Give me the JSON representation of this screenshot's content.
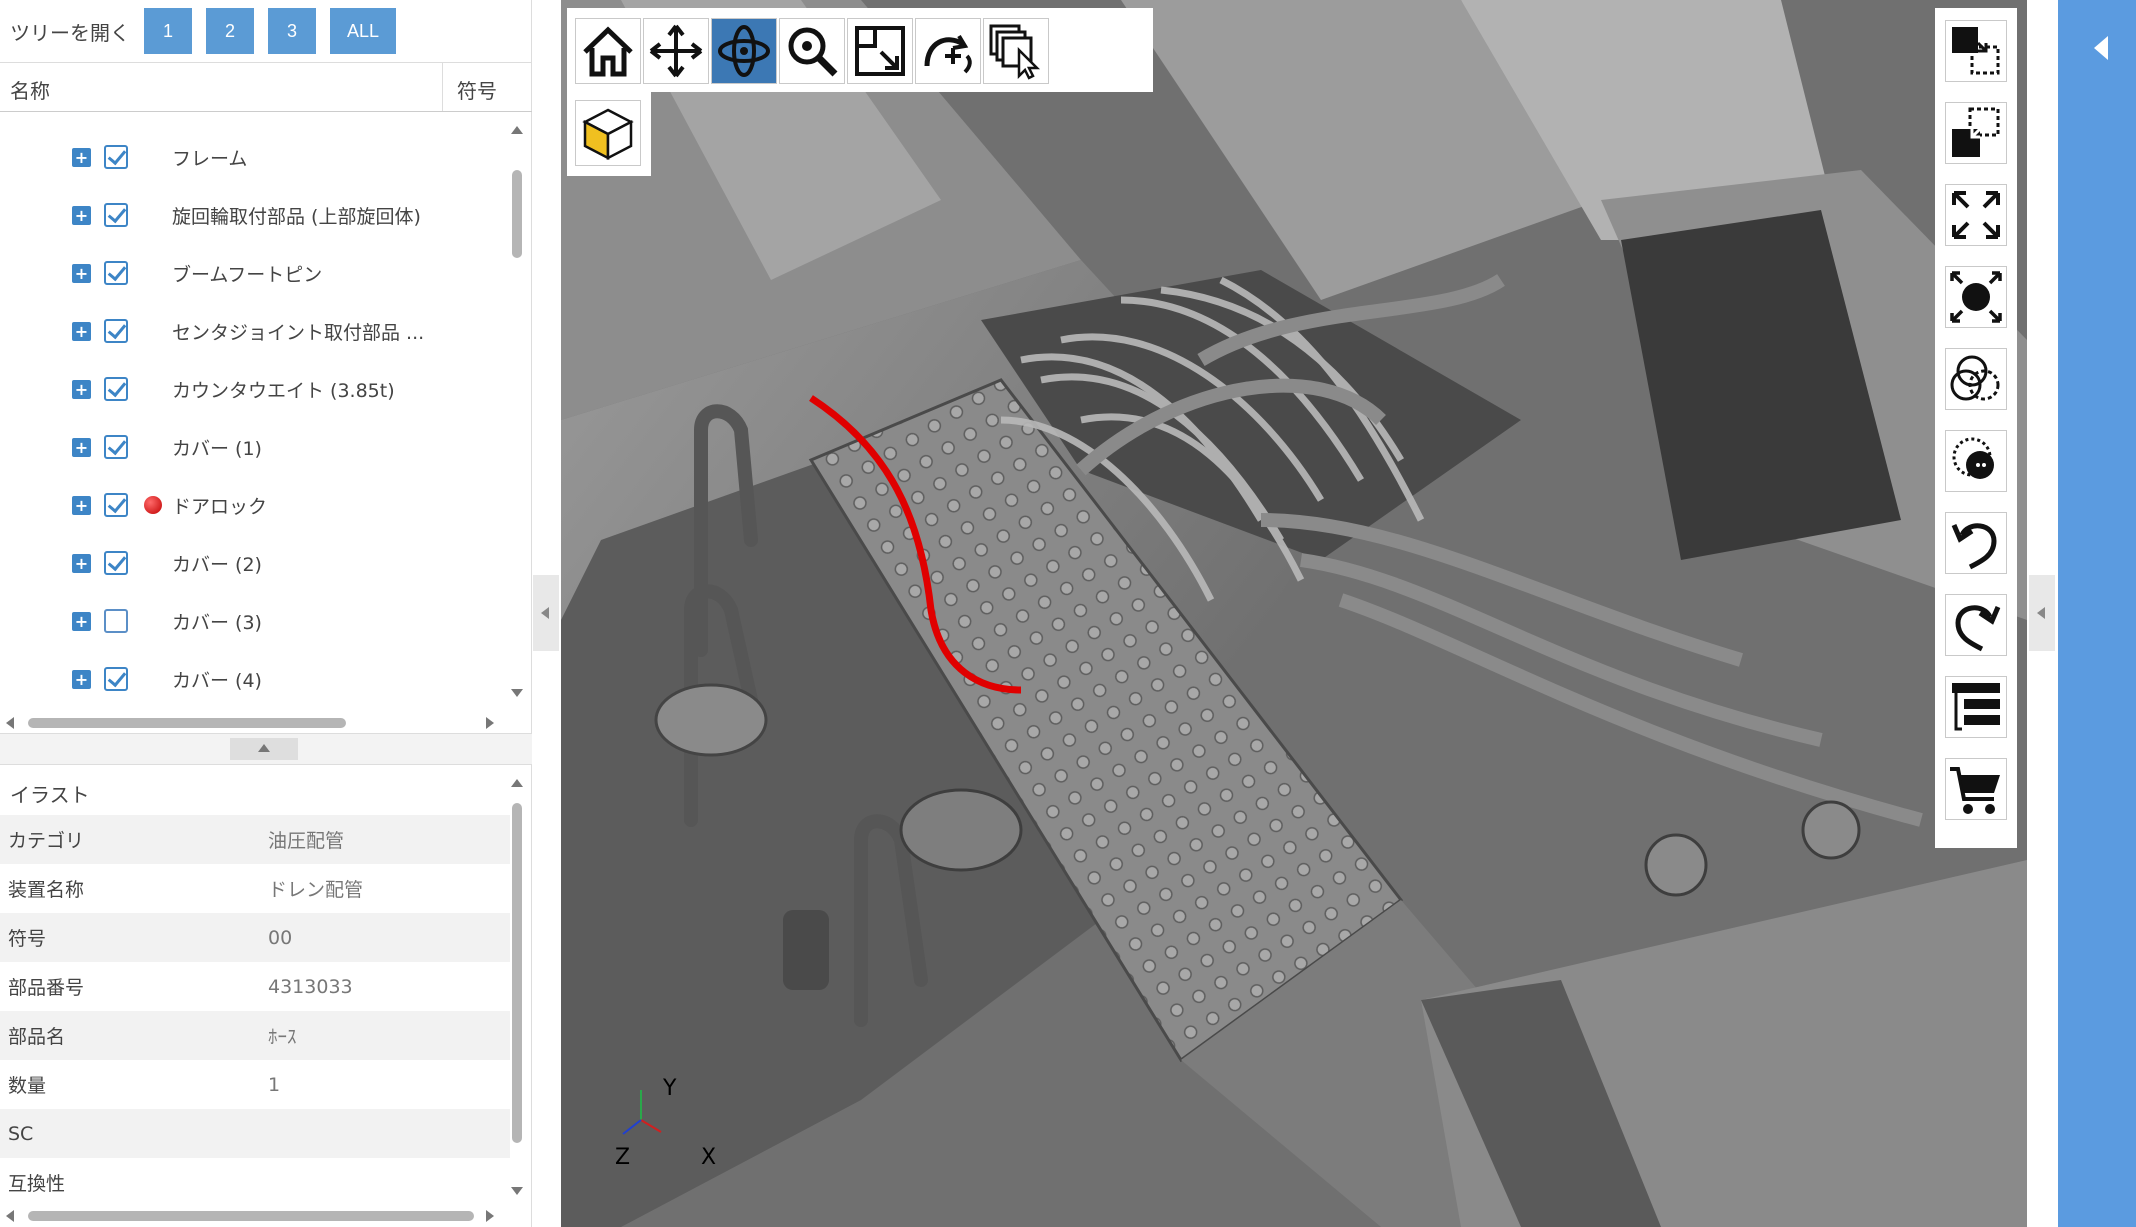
{
  "tree_toolbar": {
    "open_tree_label": "ツリーを開く",
    "level_buttons": [
      "1",
      "2",
      "3",
      "ALL"
    ]
  },
  "tree_header": {
    "name_col": "名称",
    "code_col": "符号"
  },
  "tree_items": [
    {
      "label": "フレーム",
      "checked": true,
      "marker": false
    },
    {
      "label": "旋回輪取付部品 (上部旋回体)",
      "checked": true,
      "marker": false
    },
    {
      "label": "ブームフートピン",
      "checked": true,
      "marker": false
    },
    {
      "label": "センタジョイント取付部品 ...",
      "checked": true,
      "marker": false
    },
    {
      "label": "カウンタウエイト (3.85t)",
      "checked": true,
      "marker": false
    },
    {
      "label": "カバー (1)",
      "checked": true,
      "marker": false
    },
    {
      "label": "ドアロック",
      "checked": true,
      "marker": true
    },
    {
      "label": "カバー (2)",
      "checked": true,
      "marker": false
    },
    {
      "label": "カバー (3)",
      "checked": false,
      "marker": false
    },
    {
      "label": "カバー (4)",
      "checked": true,
      "marker": false
    }
  ],
  "properties": {
    "title": "イラスト",
    "rows": [
      {
        "key": "カテゴリ",
        "value": "油圧配管"
      },
      {
        "key": "装置名称",
        "value": "ドレン配管"
      },
      {
        "key": "符号",
        "value": "00"
      },
      {
        "key": "部品番号",
        "value": "4313033"
      },
      {
        "key": "部品名",
        "value": "ﾎｰｽ"
      },
      {
        "key": "数量",
        "value": "1"
      },
      {
        "key": "SC",
        "value": ""
      },
      {
        "key": "互換性",
        "value": ""
      }
    ]
  },
  "viewport": {
    "axis_labels": {
      "x": "X",
      "y": "Y",
      "z": "Z"
    },
    "top_tools": [
      "home-icon",
      "pan-icon",
      "orbit-icon",
      "zoom-icon",
      "zoom-window-icon",
      "rotate-plus-icon",
      "select-multiple-icon"
    ],
    "active_tool": "orbit-icon",
    "second_row_tools": [
      "view-cube-icon"
    ],
    "right_tools": [
      "select-front-icon",
      "select-back-icon",
      "fit-all-icon",
      "fit-selected-icon",
      "transparency-icon",
      "isolate-icon",
      "undo-icon",
      "redo-icon",
      "list-icon",
      "cart-icon"
    ]
  },
  "colors": {
    "accent": "#5b9bd5",
    "active_tool": "#3c78b4",
    "highlight_part": "#e00000",
    "right_sidebar": "#5b9be0"
  }
}
